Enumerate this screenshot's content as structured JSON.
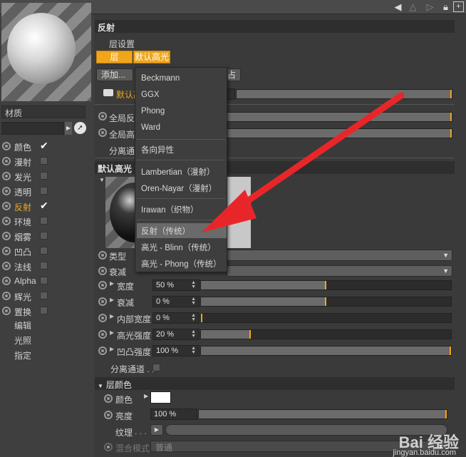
{
  "left": {
    "material_label": "材质",
    "channels": [
      {
        "label": "颜色",
        "checked": true,
        "active": false
      },
      {
        "label": "漫射",
        "checked": false,
        "active": false
      },
      {
        "label": "发光",
        "checked": false,
        "active": false
      },
      {
        "label": "透明",
        "checked": false,
        "active": false
      },
      {
        "label": "反射",
        "checked": true,
        "active": true
      },
      {
        "label": "环境",
        "checked": false,
        "active": false
      },
      {
        "label": "烟雾",
        "checked": false,
        "active": false
      },
      {
        "label": "凹凸",
        "checked": false,
        "active": false
      },
      {
        "label": "法线",
        "checked": false,
        "active": false
      },
      {
        "label": "Alpha",
        "checked": false,
        "active": false
      },
      {
        "label": "辉光",
        "checked": false,
        "active": false
      },
      {
        "label": "置换",
        "checked": false,
        "active": false
      }
    ],
    "extras": [
      "编辑",
      "光照",
      "指定"
    ]
  },
  "main": {
    "section_title": "反射",
    "layer_settings": "层设置",
    "tab_layer": "层",
    "tab_default_spec": "默认高光",
    "add_button": "添加...",
    "hidden_btn_tail": "占",
    "layer_row_label": "默认高",
    "global_reflect": "全局反",
    "global_spec": "全局高",
    "separate_pass": "分离通道",
    "sub_section": "默认高光",
    "type_label": "类型",
    "atten_label": "衰减",
    "width_label": "宽度",
    "width_value": "50 %",
    "falloff_label": "衰减",
    "falloff_value": "0 %",
    "inner_width_label": "内部宽度",
    "inner_width_value": "0 %",
    "spec_strength_label": "高光强度",
    "spec_strength_value": "20 %",
    "bump_strength_label": "凹凸强度",
    "bump_strength_value": "100 %",
    "separate_pass2": "分离通道 . .",
    "layer_color_head": "层颜色",
    "color_label": "颜色",
    "brightness_label": "亮度",
    "brightness_value": "100 %",
    "texture_label": "纹理",
    "blend_mode_label": "混合模式",
    "blend_mode_value": "普通"
  },
  "menu": {
    "items": [
      "Beckmann",
      "GGX",
      "Phong",
      "Ward",
      "各向异性",
      "Lambertian（漫射）",
      "Oren-Nayar（漫射）",
      "Irawan（织物）",
      "反射（传统）",
      "高光 - Blinn（传统）",
      "高光 - Phong（传统）"
    ],
    "highlighted": "反射（传统）"
  },
  "watermark": {
    "brand": "Bai 经验",
    "url": "jingyan.baidu.com"
  },
  "colors": {
    "accent": "#f0a51b",
    "arrow": "#e8262a"
  }
}
